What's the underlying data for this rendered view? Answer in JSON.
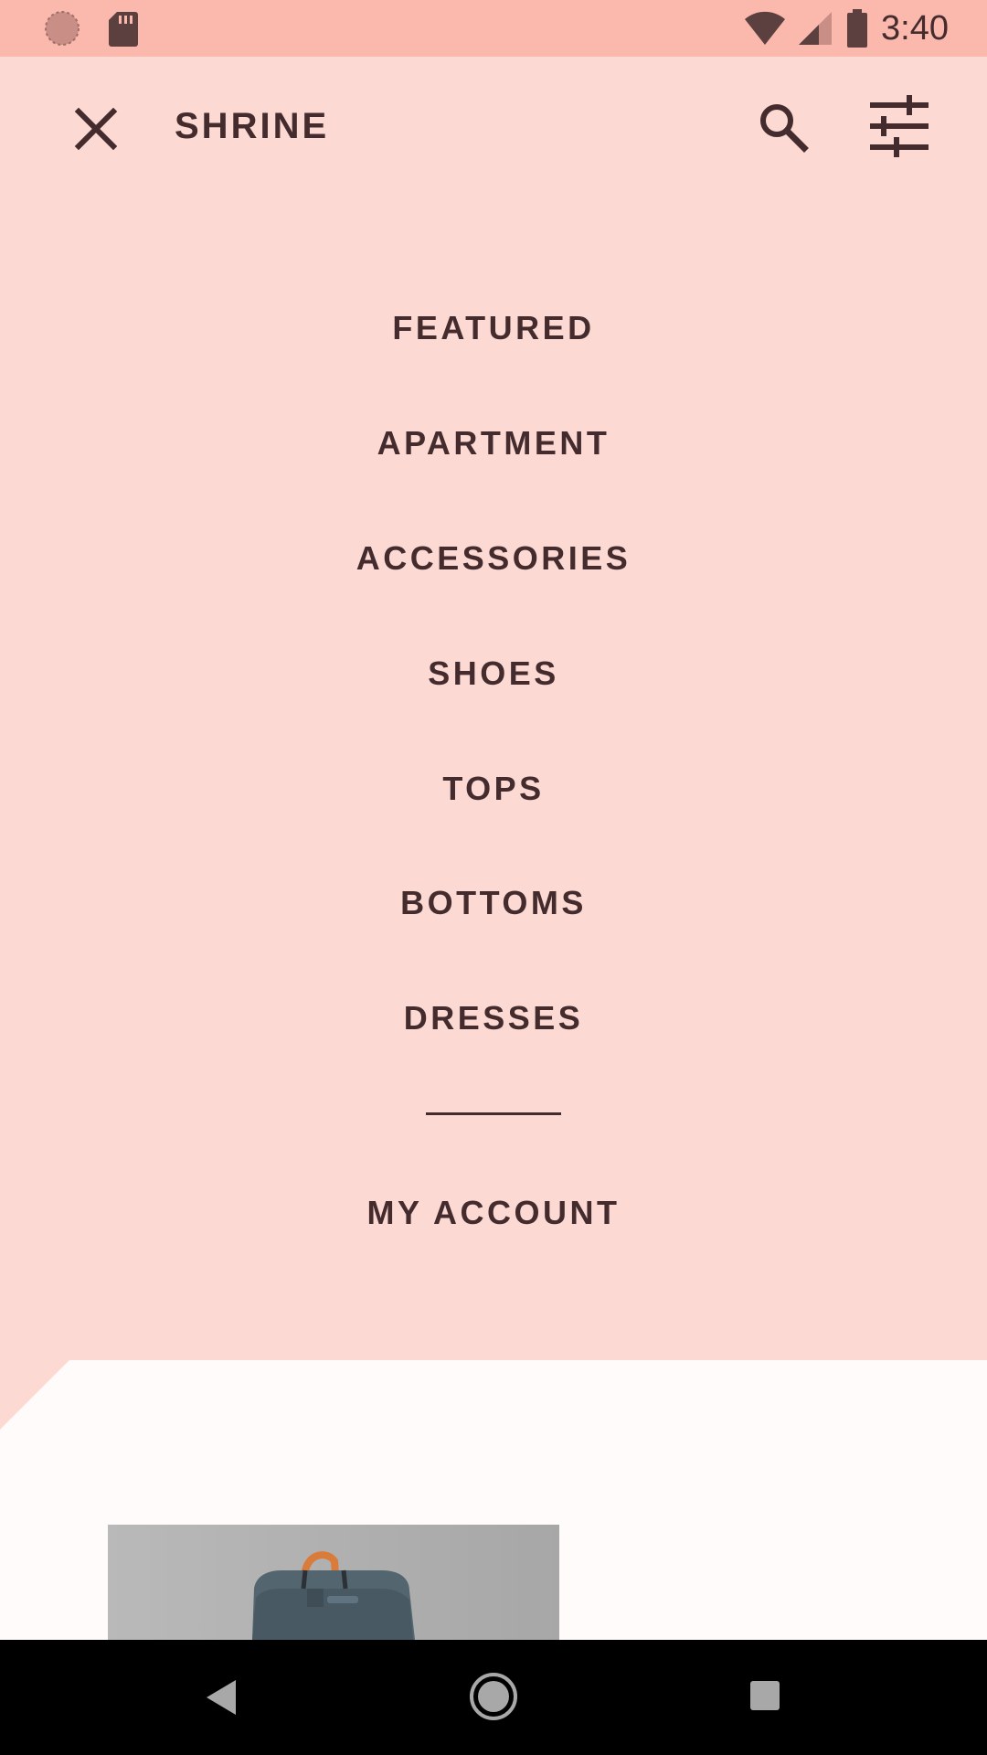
{
  "status_bar": {
    "time": "3:40",
    "icons": [
      "circle-indicator-icon",
      "sd-card-icon",
      "wifi-icon",
      "cell-signal-icon",
      "battery-icon"
    ]
  },
  "app_bar": {
    "title": "SHRINE",
    "icons": [
      "close-icon",
      "search-icon",
      "tune-icon"
    ]
  },
  "menu": {
    "items": [
      "FEATURED",
      "APARTMENT",
      "ACCESSORIES",
      "SHOES",
      "TOPS",
      "BOTTOMS",
      "DRESSES"
    ],
    "account": "MY ACCOUNT"
  },
  "nav_bar": {
    "icons": [
      "back-icon",
      "home-icon",
      "recents-icon"
    ]
  },
  "colors": {
    "backdrop": "#FCD9D2",
    "status_bar": "#FBB8AC",
    "text": "#442C2E",
    "front_layer": "#FFFBFA"
  }
}
